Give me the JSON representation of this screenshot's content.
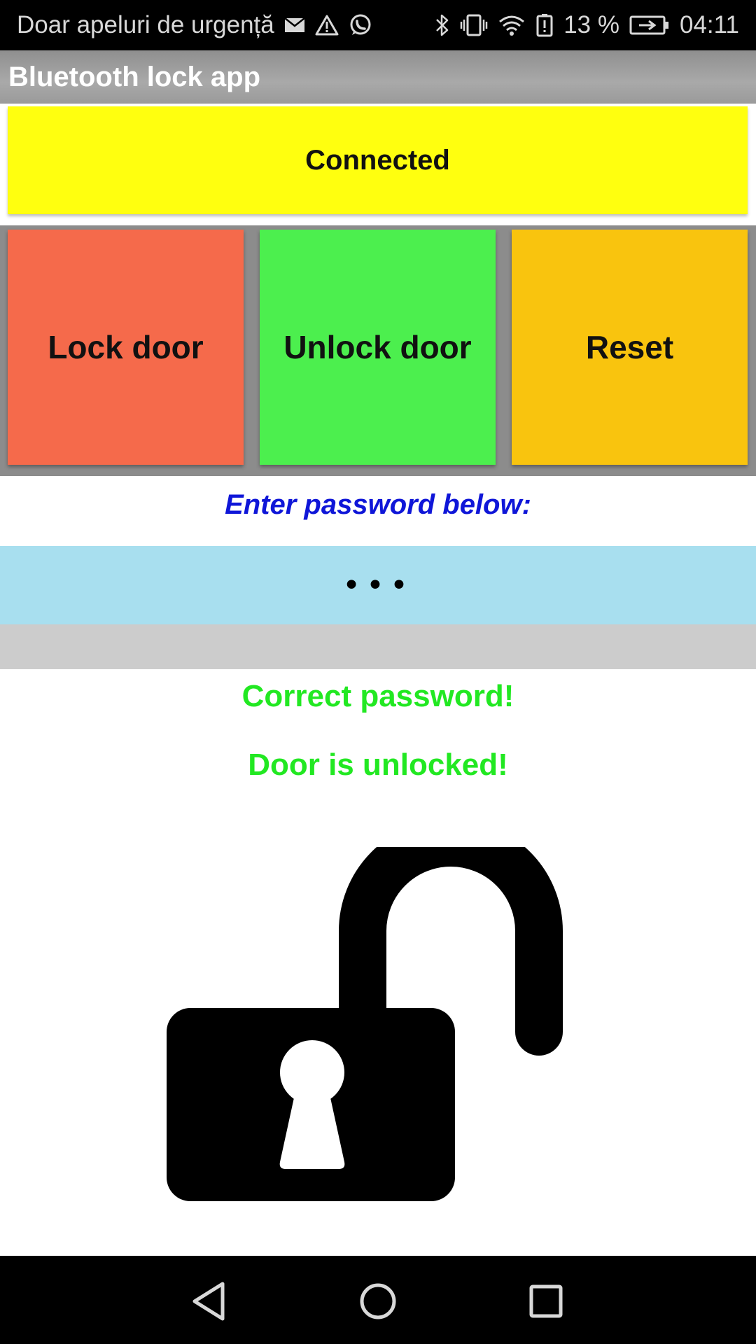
{
  "status_bar": {
    "carrier_text": "Doar apeluri de urgență",
    "notification_icons": [
      "mail-icon",
      "warning-icon",
      "whatsapp-icon"
    ],
    "system_icons": [
      "bluetooth-icon",
      "vibrate-icon",
      "wifi-icon",
      "battery-alert-icon"
    ],
    "battery_percent": "13 %",
    "time": "04:11"
  },
  "app_bar": {
    "title": "Bluetooth lock app"
  },
  "connection": {
    "status": "Connected",
    "color": "#ffff0f"
  },
  "actions": {
    "lock_label": "Lock door",
    "unlock_label": "Unlock door",
    "reset_label": "Reset",
    "lock_color": "#f56a4b",
    "unlock_color": "#4cef4e",
    "reset_color": "#f9c40e"
  },
  "password": {
    "prompt": "Enter password below:",
    "value": "•••"
  },
  "result": {
    "password_message": "Correct password!",
    "door_message": "Door is unlocked!",
    "color": "#22e822"
  },
  "lock_state_icon": "unlocked-padlock-icon",
  "nav_bar": {
    "icons": [
      "back-icon",
      "home-icon",
      "recent-apps-icon"
    ]
  }
}
